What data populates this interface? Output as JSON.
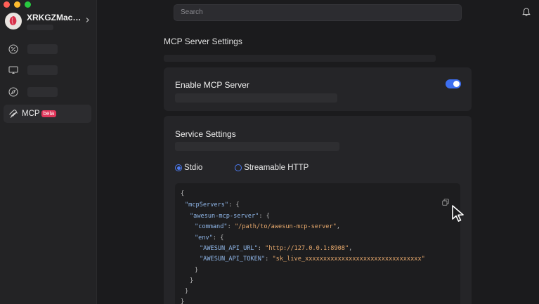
{
  "profile": {
    "name": "XRKGZMacb..."
  },
  "nav": {
    "mcp_label": "MCP",
    "beta_badge": "beta"
  },
  "search": {
    "placeholder": "Search"
  },
  "page": {
    "title": "MCP Server Settings"
  },
  "enable_card": {
    "title": "Enable MCP Server",
    "toggle_on": true
  },
  "service_card": {
    "title": "Service Settings",
    "radio_stdio": "Stdio",
    "radio_http": "Streamable HTTP",
    "selected": "Stdio"
  },
  "code": {
    "l1": "{",
    "l2_key": "\"mcpServers\"",
    "l2_rest": ": {",
    "l3_key": "\"awesun-mcp-server\"",
    "l3_rest": ": {",
    "l4_key": "\"command\"",
    "l4_sep": ": ",
    "l4_val": "\"/path/to/awesun-mcp-server\"",
    "l4_end": ",",
    "l5_key": "\"env\"",
    "l5_rest": ": {",
    "l6_key": "\"AWESUN_API_URL\"",
    "l6_sep": ": ",
    "l6_val": "\"http://127.0.0.1:8908\"",
    "l6_end": ",",
    "l7_key": "\"AWESUN_API_TOKEN\"",
    "l7_sep": ": ",
    "l7_val": "\"sk_live_xxxxxxxxxxxxxxxxxxxxxxxxxxxxxxxx\"",
    "l8": "}",
    "l9": "}",
    "l10": "}",
    "l11": "}"
  },
  "colors": {
    "accent": "#3d6ff0",
    "beta": "#e0365a",
    "code_key": "#8fb6e8",
    "code_string": "#e6a86c"
  }
}
